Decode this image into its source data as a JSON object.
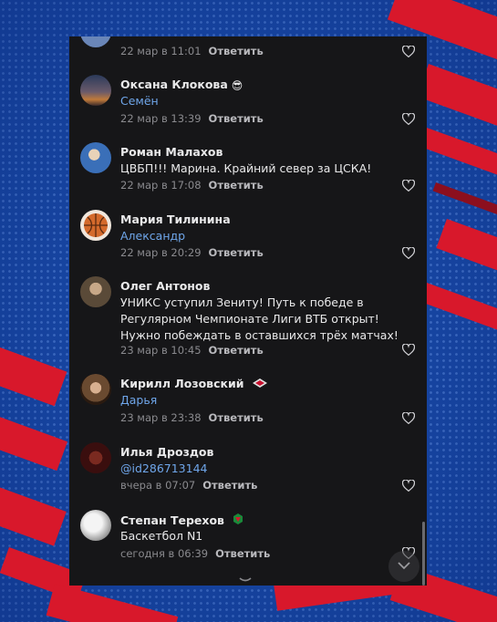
{
  "colors": {
    "panel_bg": "#161618",
    "text": "#e9e9ea",
    "mention_link": "#6fa6ea",
    "meta": "#8a8a8e",
    "background_blue": "#1b4fb0",
    "background_red": "#d8182b"
  },
  "comments": [
    {
      "name": "",
      "text": "",
      "mention": "",
      "time": "22 мар в 11:01",
      "reply_label": "Ответить",
      "avatar_icon": "user-photo-icon",
      "avatar_color": "#6a86b8"
    },
    {
      "name": "Оксана Клокова",
      "badge": "😎",
      "badge_icon": "sunglasses-emoji-icon",
      "mention": "Семён",
      "time": "22 мар в 13:39",
      "reply_label": "Ответить",
      "avatar_icon": "sunset-photo-icon",
      "avatar_color": "#c07a3a"
    },
    {
      "name": "Роман Малахов",
      "text": "ЦВБП!!! Марина. Крайний север за ЦСКА!",
      "time": "22 мар в 17:08",
      "reply_label": "Ответить",
      "avatar_icon": "user-photo-icon",
      "avatar_color": "#3a6fb8"
    },
    {
      "name": "Мария Тилинина",
      "mention": "Александр",
      "time": "22 мар в 20:29",
      "reply_label": "Ответить",
      "avatar_icon": "basketball-icon",
      "avatar_color": "#d46a2c"
    },
    {
      "name": "Олег Антонов",
      "text": "УНИКС уступил Зениту! Путь к победе в Регулярном Чемпионате Лиги ВТБ открыт! Нужно побеждать в оставшихся трёх матчах!",
      "time": "23 мар в 10:45",
      "reply_label": "Ответить",
      "avatar_icon": "user-photo-icon",
      "avatar_color": "#7a6a50"
    },
    {
      "name": "Кирилл Лозовский",
      "badge_icon": "spartak-logo-icon",
      "mention": "Дарья",
      "time": "23 мар в 23:38",
      "reply_label": "Ответить",
      "avatar_icon": "user-photo-icon",
      "avatar_color": "#8a5a3a"
    },
    {
      "name": "Илья Дроздов",
      "mention": "@id286713144",
      "time": "вчера в 07:07",
      "reply_label": "Ответить",
      "avatar_icon": "user-photo-icon",
      "avatar_color": "#5a1a1a"
    },
    {
      "name": "Степан Терехов",
      "badge_icon": "lokomotiv-logo-icon",
      "text": "Баскетбол N1",
      "time": "сегодня в 06:39",
      "reply_label": "Ответить",
      "avatar_icon": "moon-photo-icon",
      "avatar_color": "#d8d8d8"
    }
  ],
  "icons": {
    "like": "heart-outline-icon",
    "scroll_down": "chevron-down-icon"
  }
}
